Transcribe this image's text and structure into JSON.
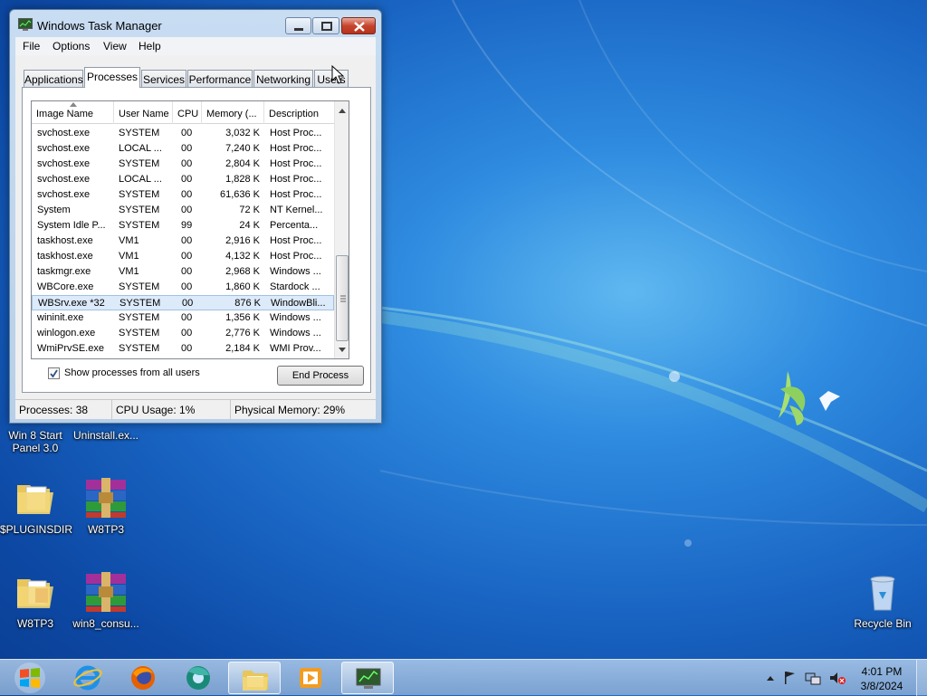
{
  "window": {
    "title": "Windows Task Manager",
    "menu": [
      "File",
      "Options",
      "View",
      "Help"
    ],
    "tabs": [
      "Applications",
      "Processes",
      "Services",
      "Performance",
      "Networking",
      "Users"
    ],
    "active_tab": "Processes"
  },
  "process_table": {
    "columns": [
      "Image Name",
      "User Name",
      "CPU",
      "Memory (...",
      "Description"
    ],
    "rows": [
      {
        "image": "svchost.exe",
        "user": "SYSTEM",
        "cpu": "00",
        "memory": "3,032 K",
        "desc": "Host Proc..."
      },
      {
        "image": "svchost.exe",
        "user": "LOCAL ...",
        "cpu": "00",
        "memory": "7,240 K",
        "desc": "Host Proc..."
      },
      {
        "image": "svchost.exe",
        "user": "SYSTEM",
        "cpu": "00",
        "memory": "2,804 K",
        "desc": "Host Proc..."
      },
      {
        "image": "svchost.exe",
        "user": "LOCAL ...",
        "cpu": "00",
        "memory": "1,828 K",
        "desc": "Host Proc..."
      },
      {
        "image": "svchost.exe",
        "user": "SYSTEM",
        "cpu": "00",
        "memory": "61,636 K",
        "desc": "Host Proc..."
      },
      {
        "image": "System",
        "user": "SYSTEM",
        "cpu": "00",
        "memory": "72 K",
        "desc": "NT Kernel..."
      },
      {
        "image": "System Idle P...",
        "user": "SYSTEM",
        "cpu": "99",
        "memory": "24 K",
        "desc": "Percenta..."
      },
      {
        "image": "taskhost.exe",
        "user": "VM1",
        "cpu": "00",
        "memory": "2,916 K",
        "desc": "Host Proc..."
      },
      {
        "image": "taskhost.exe",
        "user": "VM1",
        "cpu": "00",
        "memory": "4,132 K",
        "desc": "Host Proc..."
      },
      {
        "image": "taskmgr.exe",
        "user": "VM1",
        "cpu": "00",
        "memory": "2,968 K",
        "desc": "Windows ..."
      },
      {
        "image": "WBCore.exe",
        "user": "SYSTEM",
        "cpu": "00",
        "memory": "1,860 K",
        "desc": "Stardock ..."
      },
      {
        "image": "WBSrv.exe *32",
        "user": "SYSTEM",
        "cpu": "00",
        "memory": "876 K",
        "desc": "WindowBli...",
        "selected": true
      },
      {
        "image": "wininit.exe",
        "user": "SYSTEM",
        "cpu": "00",
        "memory": "1,356 K",
        "desc": "Windows ..."
      },
      {
        "image": "winlogon.exe",
        "user": "SYSTEM",
        "cpu": "00",
        "memory": "2,776 K",
        "desc": "Windows ..."
      },
      {
        "image": "WmiPrvSE.exe",
        "user": "SYSTEM",
        "cpu": "00",
        "memory": "2,184 K",
        "desc": "WMI Prov..."
      }
    ]
  },
  "controls": {
    "show_all_label": "Show processes from all users",
    "show_all_checked": true,
    "end_process_label": "End Process"
  },
  "status_bar": {
    "processes": "Processes: 38",
    "cpu": "CPU Usage: 1%",
    "memory": "Physical Memory: 29%"
  },
  "desktop_icons": [
    {
      "label": "Win 8 Start Panel 3.0",
      "icon": "app-icon"
    },
    {
      "label": "Uninstall.ex...",
      "icon": "app-icon"
    },
    {
      "label": "$PLUGINSDIR",
      "icon": "folder-icon"
    },
    {
      "label": "W8TP3",
      "icon": "winrar-archive-icon"
    },
    {
      "label": "W8TP3",
      "icon": "folder-icon"
    },
    {
      "label": "win8_consu...",
      "icon": "winrar-archive-icon"
    },
    {
      "label": "Recycle Bin",
      "icon": "recycle-bin-icon"
    }
  ],
  "taskbar": {
    "pinned": [
      "internet-explorer-icon",
      "firefox-icon",
      "chrome-like-icon",
      "file-explorer-icon",
      "media-player-icon",
      "task-manager-icon"
    ],
    "clock_time": "4:01 PM",
    "clock_date": "3/8/2024"
  },
  "colors": {
    "desktop_blue": "#1a66c4",
    "selection": "#dceaf9",
    "close_red": "#c7452d"
  }
}
